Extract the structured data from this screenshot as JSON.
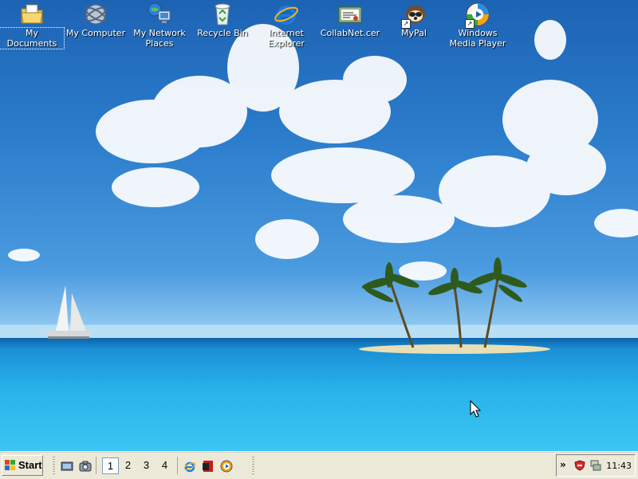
{
  "desktop": {
    "icons": [
      {
        "label": "My Documents",
        "icon": "my-documents-icon"
      },
      {
        "label": "My Computer",
        "icon": "my-computer-icon"
      },
      {
        "label": "My Network Places",
        "icon": "network-places-icon"
      },
      {
        "label": "Recycle Bin",
        "icon": "recycle-bin-icon"
      },
      {
        "label": "Internet Explorer",
        "icon": "internet-explorer-icon"
      },
      {
        "label": "CollabNet.cer",
        "icon": "certificate-icon"
      },
      {
        "label": "MyPal",
        "icon": "mypal-icon"
      },
      {
        "label": "Windows Media Player",
        "icon": "media-player-icon"
      }
    ],
    "selected_icon": "My Documents"
  },
  "taskbar": {
    "start_label": "Start",
    "quick_launch": [
      "show-desktop-icon",
      "screenshot-icon"
    ],
    "virtual_desktops": [
      "1",
      "2",
      "3",
      "4"
    ],
    "active_desktop": "1",
    "pinned_apps": [
      "internet-explorer-icon",
      "acrobat-icon",
      "media-player-icon"
    ],
    "tray": {
      "chevron": "»",
      "icons": [
        "antivirus-shield-icon",
        "network-tray-icon"
      ],
      "clock": "11:43"
    }
  },
  "colors": {
    "taskbar": "#ece9d8",
    "sky_top": "#1d63b4",
    "sea": "#27b2ea"
  }
}
